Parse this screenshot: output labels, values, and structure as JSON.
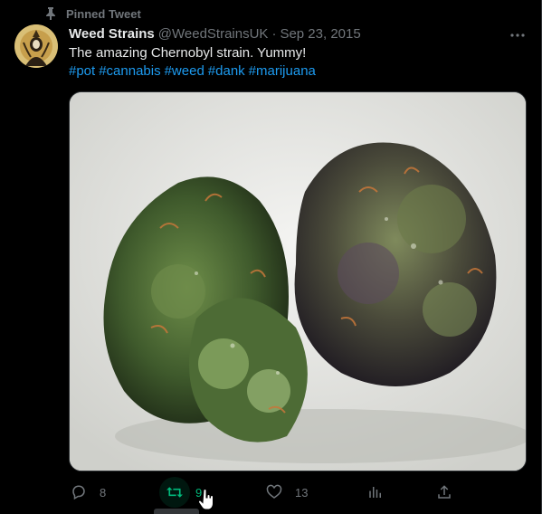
{
  "pinned": {
    "label": "Pinned Tweet",
    "icon": "pin-icon"
  },
  "author": {
    "display_name": "Weed Strains",
    "handle": "@WeedStrainsUK",
    "separator": "·",
    "date": "Sep 23, 2015"
  },
  "tweet": {
    "text": "The amazing Chernobyl strain. Yummy!",
    "hashtags": [
      "#pot",
      "#cannabis",
      "#weed",
      "#dank",
      "#marijuana"
    ]
  },
  "actions": {
    "reply": {
      "icon": "reply-icon",
      "count": "8"
    },
    "retweet": {
      "icon": "retweet-icon",
      "count": "9",
      "active": true
    },
    "like": {
      "icon": "heart-icon",
      "count": "13"
    },
    "views": {
      "icon": "analytics-icon"
    },
    "share": {
      "icon": "share-icon"
    }
  },
  "colors": {
    "background": "#000000",
    "text": "#e7e9ea",
    "muted": "#71767b",
    "link": "#1d9bf0",
    "retweet_green": "#00ba7c"
  }
}
